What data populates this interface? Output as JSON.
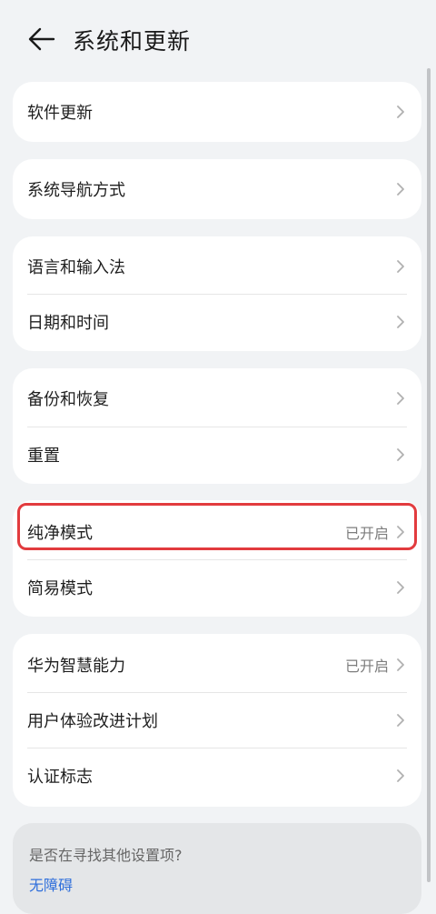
{
  "header": {
    "title": "系统和更新",
    "back_icon": "arrow-left-icon"
  },
  "groups": [
    {
      "items": [
        {
          "label": "软件更新",
          "value": ""
        }
      ]
    },
    {
      "items": [
        {
          "label": "系统导航方式",
          "value": ""
        }
      ]
    },
    {
      "items": [
        {
          "label": "语言和输入法",
          "value": ""
        },
        {
          "label": "日期和时间",
          "value": ""
        }
      ]
    },
    {
      "items": [
        {
          "label": "备份和恢复",
          "value": ""
        },
        {
          "label": "重置",
          "value": ""
        }
      ]
    },
    {
      "items": [
        {
          "label": "纯净模式",
          "value": "已开启"
        },
        {
          "label": "简易模式",
          "value": ""
        }
      ]
    },
    {
      "items": [
        {
          "label": "华为智慧能力",
          "value": "已开启"
        },
        {
          "label": "用户体验改进计划",
          "value": ""
        },
        {
          "label": "认证标志",
          "value": ""
        }
      ]
    }
  ],
  "footer": {
    "question": "是否在寻找其他设置项?",
    "link": "无障碍"
  },
  "colors": {
    "background": "#f1f3f5",
    "card": "#ffffff",
    "highlight": "#e23b3e",
    "link": "#2f6fdb"
  }
}
